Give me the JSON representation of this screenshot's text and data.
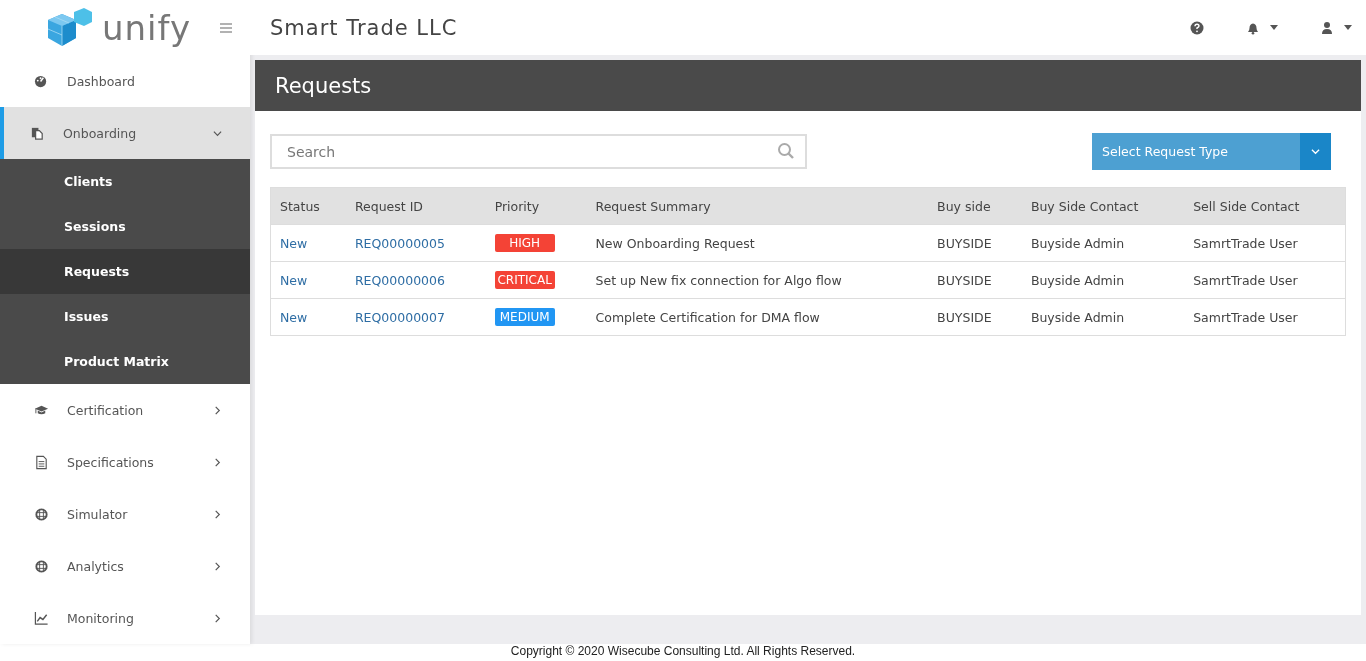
{
  "brand": {
    "logo_text": "unify"
  },
  "header": {
    "company": "Smart Trade LLC"
  },
  "sidebar": {
    "items": [
      {
        "label": "Dashboard",
        "kind": "link",
        "selected": false
      },
      {
        "label": "Onboarding",
        "kind": "group",
        "selected": true,
        "expanded": true,
        "children": [
          {
            "label": "Clients",
            "selected": false
          },
          {
            "label": "Sessions",
            "selected": false
          },
          {
            "label": "Requests",
            "selected": true
          },
          {
            "label": "Issues",
            "selected": false
          },
          {
            "label": "Product Matrix",
            "selected": false
          }
        ]
      },
      {
        "label": "Certification",
        "kind": "group",
        "selected": false,
        "expanded": false
      },
      {
        "label": "Specifications",
        "kind": "group",
        "selected": false,
        "expanded": false
      },
      {
        "label": "Simulator",
        "kind": "group",
        "selected": false,
        "expanded": false
      },
      {
        "label": "Analytics",
        "kind": "group",
        "selected": false,
        "expanded": false
      },
      {
        "label": "Monitoring",
        "kind": "group",
        "selected": false,
        "expanded": false
      }
    ]
  },
  "page": {
    "title": "Requests",
    "search": {
      "placeholder": "Search"
    },
    "request_type": {
      "label": "Select Request Type"
    },
    "table": {
      "columns": [
        "Status",
        "Request ID",
        "Priority",
        "Request Summary",
        "Buy side",
        "Buy Side Contact",
        "Sell Side Contact"
      ],
      "rows": [
        {
          "status": "New",
          "request_id": "REQ00000005",
          "priority": "HIGH",
          "color": "#f44336",
          "summary": "New Onboarding Request",
          "buy_side": "BUYSIDE",
          "buy_side_contact": "Buyside Admin",
          "sell_side_contact": "SamrtTrade User"
        },
        {
          "status": "New",
          "request_id": "REQ00000006",
          "priority": "CRITICAL",
          "color": "#f44336",
          "summary": "Set up New fix connection for Algo flow",
          "buy_side": "BUYSIDE",
          "buy_side_contact": "Buyside Admin",
          "sell_side_contact": "SamrtTrade User"
        },
        {
          "status": "New",
          "request_id": "REQ00000007",
          "priority": "MEDIUM",
          "color": "#2196f3",
          "summary": "Complete Certification for DMA flow",
          "buy_side": "BUYSIDE",
          "buy_side_contact": "Buyside Admin",
          "sell_side_contact": "SamrtTrade User"
        }
      ]
    }
  },
  "footer": {
    "copyright": "Copyright © 2020 Wisecube Consulting Ltd. All Rights Reserved."
  }
}
